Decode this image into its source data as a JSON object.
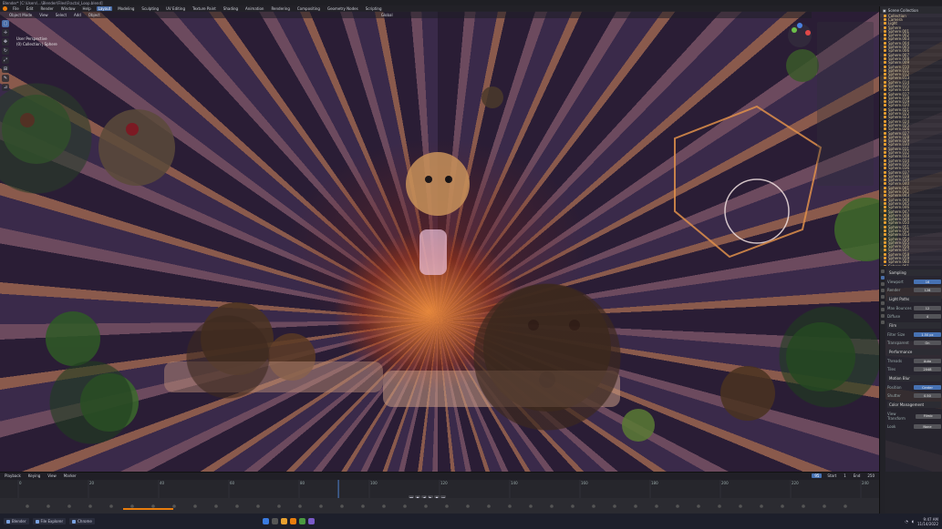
{
  "window": {
    "title": "Blender* [C:\\Users\\...\\Blender\\Files\\Fractal_Loop.blend]"
  },
  "menu": {
    "items": [
      "File",
      "Edit",
      "Render",
      "Window",
      "Help"
    ],
    "workspaces": [
      "Layout",
      "Modeling",
      "Sculpting",
      "UV Editing",
      "Texture Paint",
      "Shading",
      "Animation",
      "Rendering",
      "Compositing",
      "Geometry Nodes",
      "Scripting"
    ],
    "active_workspace": "Layout",
    "scene_label": "Scene",
    "view_layer_label": "ViewLayer"
  },
  "viewport": {
    "header_items": [
      "Object Mode",
      "View",
      "Select",
      "Add",
      "Object"
    ],
    "orientation": "Global",
    "overlay_lines": [
      "User Perspective",
      "(0) Collection | Sphere"
    ]
  },
  "toolbar": {
    "tools": [
      "select",
      "cursor",
      "move",
      "rotate",
      "scale",
      "transform",
      "annotate",
      "measure"
    ]
  },
  "outliner": {
    "title": "Scene Collection",
    "rows": [
      "Collection",
      "Camera",
      "Light",
      "Sphere",
      "Sphere.001",
      "Sphere.002",
      "Sphere.003",
      "Sphere.004",
      "Sphere.005",
      "Sphere.006",
      "Sphere.007",
      "Sphere.008",
      "Sphere.009",
      "Sphere.010",
      "Sphere.011",
      "Sphere.012",
      "Sphere.013",
      "Sphere.014",
      "Sphere.015",
      "Sphere.016",
      "Sphere.017",
      "Sphere.018",
      "Sphere.019",
      "Sphere.020",
      "Sphere.021",
      "Sphere.022",
      "Sphere.023",
      "Sphere.024",
      "Sphere.025",
      "Sphere.026",
      "Sphere.027",
      "Sphere.028",
      "Sphere.029",
      "Sphere.030",
      "Sphere.031",
      "Sphere.032",
      "Sphere.033",
      "Sphere.034",
      "Sphere.035",
      "Sphere.036",
      "Sphere.037",
      "Sphere.038",
      "Sphere.039",
      "Sphere.040",
      "Sphere.041",
      "Sphere.042",
      "Sphere.043",
      "Sphere.044",
      "Sphere.045",
      "Sphere.046",
      "Sphere.047",
      "Sphere.048",
      "Sphere.049",
      "Sphere.050",
      "Sphere.051",
      "Sphere.052",
      "Sphere.053",
      "Sphere.054",
      "Sphere.055",
      "Sphere.056",
      "Sphere.057",
      "Sphere.058",
      "Sphere.059",
      "Sphere.060",
      "Sphere.061"
    ]
  },
  "properties": {
    "sections": [
      {
        "title": "Sampling",
        "rows": [
          [
            "Viewport",
            "16"
          ],
          [
            "Render",
            "128"
          ]
        ]
      },
      {
        "title": "Light Paths",
        "rows": [
          [
            "Max Bounces",
            "12"
          ],
          [
            "Diffuse",
            "4"
          ]
        ]
      },
      {
        "title": "Film",
        "rows": [
          [
            "Filter Size",
            "1.50 px"
          ],
          [
            "Transparent",
            "On"
          ]
        ]
      },
      {
        "title": "Performance",
        "rows": [
          [
            "Threads",
            "Auto"
          ],
          [
            "Tiles",
            "2048"
          ]
        ]
      },
      {
        "title": "Motion Blur",
        "rows": [
          [
            "Position",
            "Center"
          ],
          [
            "Shutter",
            "0.50"
          ]
        ]
      },
      {
        "title": "Color Management",
        "rows": [
          [
            "View Transform",
            "Filmic"
          ],
          [
            "Look",
            "None"
          ]
        ]
      }
    ]
  },
  "timeline": {
    "menus": [
      "Playback",
      "Keying",
      "View",
      "Marker"
    ],
    "start_label": "Start",
    "start": "1",
    "end_label": "End",
    "end": "250",
    "current_frame": "95",
    "ticks": [
      "0",
      "20",
      "40",
      "60",
      "80",
      "100",
      "120",
      "140",
      "160",
      "180",
      "200",
      "220",
      "240"
    ],
    "playhead_fraction": 0.38
  },
  "taskbar": {
    "apps": [
      "Blender",
      "File Explorer",
      "Chrome"
    ],
    "clock_time": "9:47 AM",
    "clock_date": "11/14/2022"
  },
  "colors": {
    "accent": "#4772b3",
    "orange": "#e87d0d",
    "panel": "#2c2c33"
  }
}
